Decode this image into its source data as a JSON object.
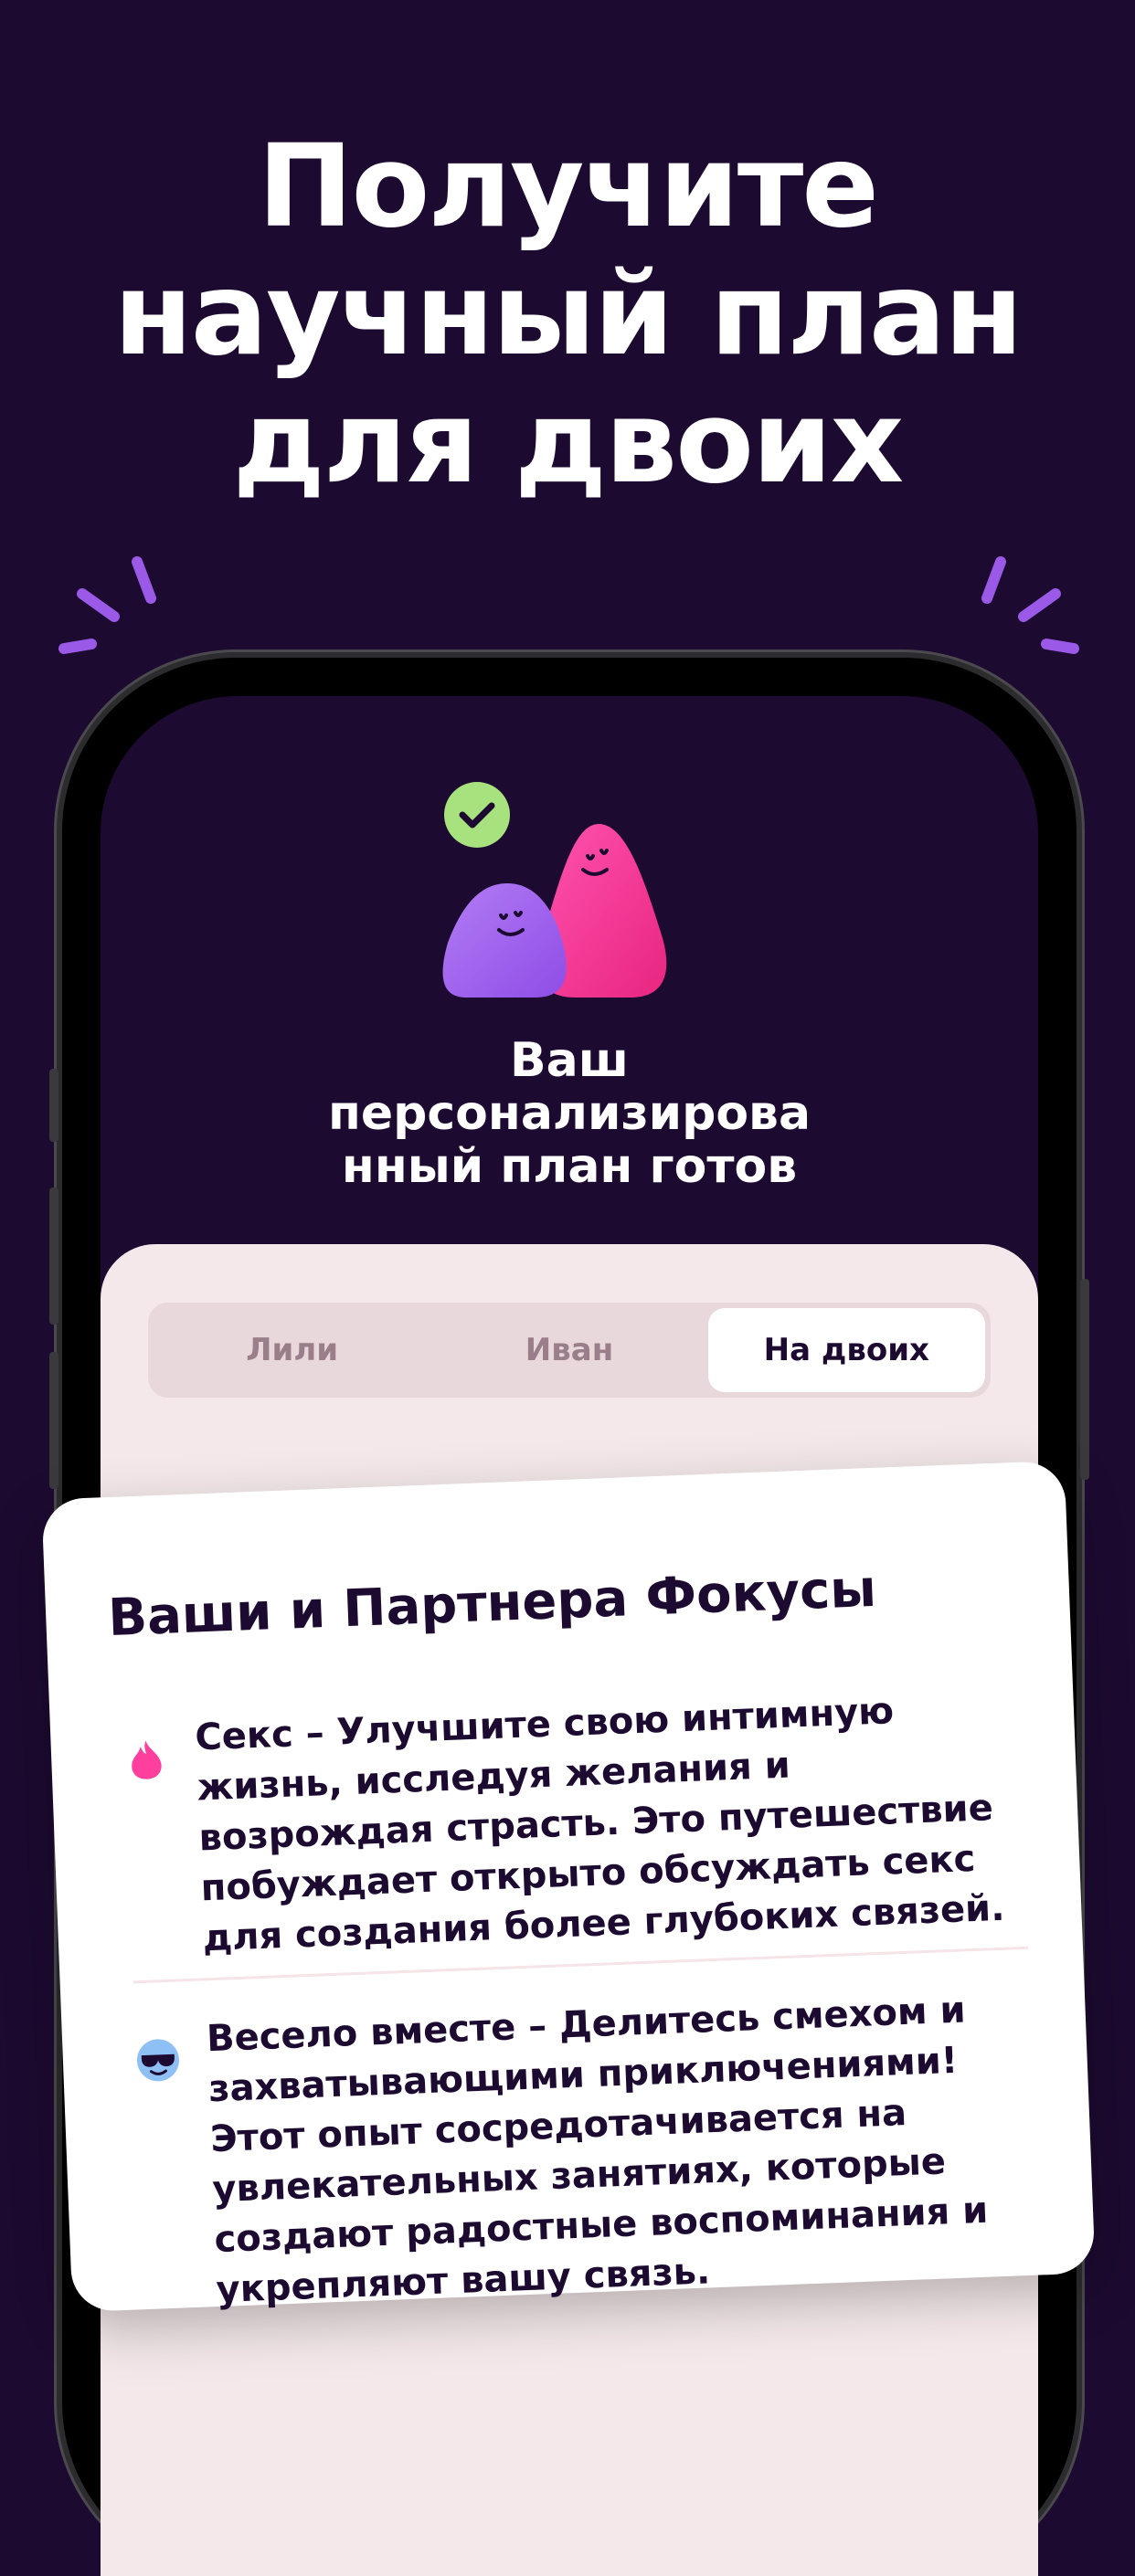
{
  "headline": {
    "lines": [
      "Получите",
      "научный план",
      "для двоих"
    ]
  },
  "plan": {
    "title_lines": [
      "Ваш",
      "персонализирова",
      "нный план готов"
    ]
  },
  "tabs": [
    {
      "label": "Лили",
      "active": false
    },
    {
      "label": "Иван",
      "active": false
    },
    {
      "label": "На двоих",
      "active": true
    }
  ],
  "focus_card": {
    "title": "Ваши и Партнера Фокусы",
    "items": [
      {
        "icon": "flame-icon",
        "text": "Секс – Улучшите свою интимную жизнь, исследуя желания и возрождая страсть. Это путешествие побуждает открыто обсуждать секс для создания более глубоких связей."
      },
      {
        "icon": "sunglasses-emoji-icon",
        "text": "Весело вместе – Делитесь смехом и захватывающими приключениями! Этот опыт сосредотачивается на увлекательных занятиях, которые создают радостные воспоминания и укрепляют вашу связь."
      }
    ]
  },
  "colors": {
    "background": "#1c0a30",
    "sheet": "#f4e8ea",
    "accent_purple": "#9b59e8",
    "accent_pink": "#ff3f9e",
    "check_green": "#a7e27e"
  }
}
